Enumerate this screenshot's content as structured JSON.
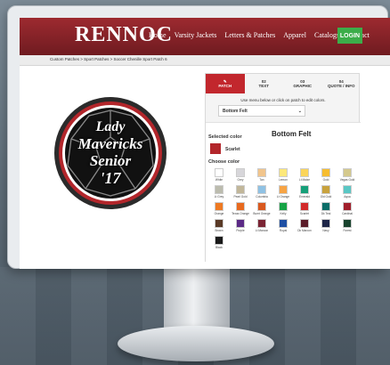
{
  "site": {
    "logo": "RENNOC",
    "nav": [
      "Home",
      "Varsity Jackets",
      "Letters & Patches",
      "Apparel",
      "Catalogs",
      "Contact"
    ],
    "login": "LOGIN"
  },
  "breadcrumb": "Custom Patches  >  Sport Patches  >  Soccer Chenille Sport Patch 6",
  "patch": {
    "lines": [
      "Lady",
      "Mavericks",
      "Senior",
      "'17"
    ],
    "colors": {
      "outer": "#2b2b2b",
      "ring": "#b3262b",
      "center": "#111111"
    }
  },
  "panel": {
    "tabs": [
      {
        "num": "",
        "label": "PATCH"
      },
      {
        "num": "02",
        "label": "TEXT"
      },
      {
        "num": "03",
        "label": "GRAPHIC"
      },
      {
        "num": "04",
        "label": "QUOTE / INFO"
      }
    ],
    "hint": "Use menu below or click on patch to edit colors.",
    "dropdown": "Bottom Felt",
    "heading": "Bottom Felt",
    "selected_label": "Selected color",
    "selected_name": "Scarlet",
    "selected_color": "#b3262b",
    "choose_label": "Choose color",
    "swatches": [
      {
        "name": "White",
        "color": "#ffffff"
      },
      {
        "name": "Grey",
        "color": "#d7d6da"
      },
      {
        "name": "Tan",
        "color": "#f1c58c"
      },
      {
        "name": "Lemon",
        "color": "#fde87a"
      },
      {
        "name": "Lt Maize",
        "color": "#fbd55a"
      },
      {
        "name": "Gold",
        "color": "#f6bd2f"
      },
      {
        "name": "Vegas Gold",
        "color": "#d4c98d"
      },
      {
        "name": "Lt Grey",
        "color": "#bcbcae"
      },
      {
        "name": "Pearl Gold",
        "color": "#c2b79a"
      },
      {
        "name": "Columbia",
        "color": "#8fc2e4"
      },
      {
        "name": "Lt Orange",
        "color": "#f7a444"
      },
      {
        "name": "Emerald",
        "color": "#16a079"
      },
      {
        "name": "Old Gold",
        "color": "#c8a23d"
      },
      {
        "name": "Aqua",
        "color": "#5ac7c4"
      },
      {
        "name": "Orange",
        "color": "#ee7a23"
      },
      {
        "name": "Texas Orange",
        "color": "#e86a1f"
      },
      {
        "name": "Burnt Orange",
        "color": "#d9591f"
      },
      {
        "name": "Kelly",
        "color": "#17a346"
      },
      {
        "name": "Scarlet",
        "color": "#d22b2b"
      },
      {
        "name": "Dk Teal",
        "color": "#0b6d68"
      },
      {
        "name": "Cardinal",
        "color": "#a11f2c"
      },
      {
        "name": "Brown",
        "color": "#5a3a26"
      },
      {
        "name": "Purple",
        "color": "#5b2a86"
      },
      {
        "name": "Lt Maroon",
        "color": "#7a2434"
      },
      {
        "name": "Royal",
        "color": "#1e4fa3"
      },
      {
        "name": "Dk Maroon",
        "color": "#5a1c29"
      },
      {
        "name": "Navy",
        "color": "#1d2547"
      },
      {
        "name": "Forest",
        "color": "#18432d"
      },
      {
        "name": "Black",
        "color": "#1a1a1a"
      }
    ]
  }
}
